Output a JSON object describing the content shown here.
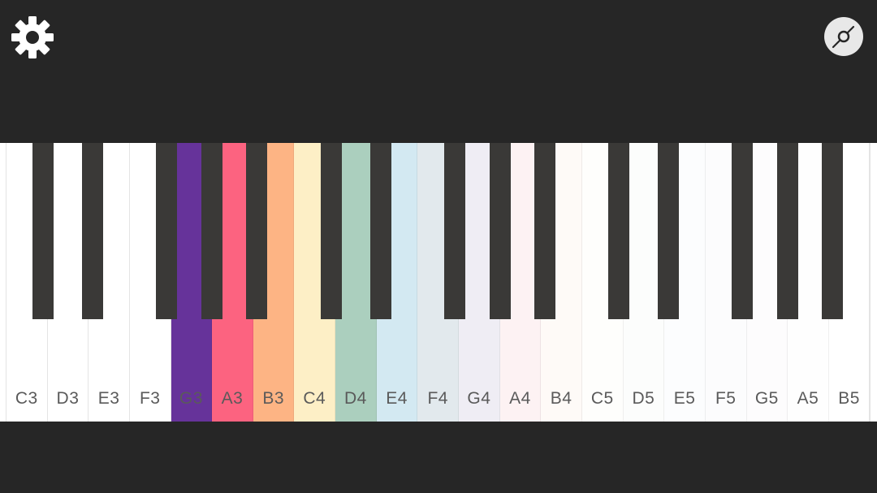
{
  "toolbar": {
    "settings_icon": "gear-icon",
    "record_icon": "vinyl-record-icon",
    "icon_color": "#ffffff"
  },
  "colors": {
    "background": "#262626",
    "white_key": "#ffffff",
    "black_key": "#3a3937",
    "label": "#5a5a5a"
  },
  "keyboard": {
    "white_keys": [
      {
        "note": "C3",
        "color": "#ffffff"
      },
      {
        "note": "D3",
        "color": "#ffffff"
      },
      {
        "note": "E3",
        "color": "#ffffff"
      },
      {
        "note": "F3",
        "color": "#ffffff"
      },
      {
        "note": "G3",
        "color": "#66339a"
      },
      {
        "note": "A3",
        "color": "#fc6380"
      },
      {
        "note": "B3",
        "color": "#fdb484"
      },
      {
        "note": "C4",
        "color": "#fdefc6"
      },
      {
        "note": "D4",
        "color": "#abcfbe"
      },
      {
        "note": "E4",
        "color": "#d3e9f2"
      },
      {
        "note": "F4",
        "color": "#e2e9ed"
      },
      {
        "note": "G4",
        "color": "#efedf4"
      },
      {
        "note": "A4",
        "color": "#fdf2f3"
      },
      {
        "note": "B4",
        "color": "#fefaf7"
      },
      {
        "note": "C5",
        "color": "#fefefc"
      },
      {
        "note": "D5",
        "color": "#fcfdfc"
      },
      {
        "note": "E5",
        "color": "#fcfdfe"
      },
      {
        "note": "F5",
        "color": "#fcfcfd"
      },
      {
        "note": "G5",
        "color": "#fdfcfd"
      },
      {
        "note": "A5",
        "color": "#fefefe"
      },
      {
        "note": "B5",
        "color": "#ffffff"
      }
    ],
    "black_keys": [
      "C#3",
      "D#3",
      "F#3",
      "G#3",
      "A#3",
      "C#4",
      "D#4",
      "F#4",
      "G#4",
      "A#4",
      "C#5",
      "D#5",
      "F#5",
      "G#5",
      "A#5"
    ]
  }
}
